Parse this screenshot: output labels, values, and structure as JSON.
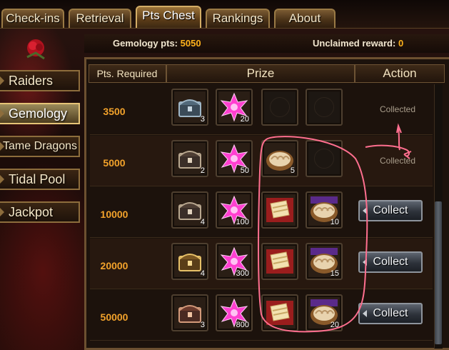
{
  "tabs": [
    {
      "label": "Check-ins",
      "active": false
    },
    {
      "label": "Retrieval",
      "active": false
    },
    {
      "label": "Pts Chest",
      "active": true
    },
    {
      "label": "Rankings",
      "active": false
    },
    {
      "label": "About",
      "active": false
    }
  ],
  "header": {
    "gemology_label": "Gemology pts:",
    "gemology_value": "5050",
    "unclaimed_label": "Unclaimed reward:",
    "unclaimed_value": "0"
  },
  "sidebar": {
    "items": [
      {
        "label": "Raiders",
        "active": false
      },
      {
        "label": "Gemology",
        "active": true
      },
      {
        "label": "Tame Dragons",
        "active": false
      },
      {
        "label": "Tidal Pool",
        "active": false
      },
      {
        "label": "Jackpot",
        "active": false
      }
    ]
  },
  "table": {
    "columns": [
      "Pts. Required",
      "Prize",
      "Action"
    ],
    "rows": [
      {
        "pts": "3500",
        "prizes": [
          {
            "icon": "silver-chest-icon",
            "qty": "3"
          },
          {
            "icon": "pink-star-gem-icon",
            "qty": "20"
          },
          {
            "icon": "empty-slot",
            "qty": ""
          },
          {
            "icon": "empty-slot",
            "qty": ""
          }
        ],
        "action": {
          "type": "status",
          "label": "Collected"
        }
      },
      {
        "pts": "5000",
        "prizes": [
          {
            "icon": "iron-chest-icon",
            "qty": "2"
          },
          {
            "icon": "pink-star-gem-icon",
            "qty": "50"
          },
          {
            "icon": "dumplings-plate-icon",
            "qty": "5"
          },
          {
            "icon": "empty-slot",
            "qty": ""
          }
        ],
        "action": {
          "type": "status",
          "label": "Collected"
        }
      },
      {
        "pts": "10000",
        "prizes": [
          {
            "icon": "iron-chest-icon",
            "qty": "4"
          },
          {
            "icon": "pink-star-gem-icon",
            "qty": "100"
          },
          {
            "icon": "scroll-tray-icon",
            "qty": ""
          },
          {
            "icon": "dumplings-plate-icon",
            "qty": "10"
          }
        ],
        "action": {
          "type": "button",
          "label": "Collect"
        }
      },
      {
        "pts": "20000",
        "prizes": [
          {
            "icon": "gold-chest-icon",
            "qty": "4"
          },
          {
            "icon": "pink-star-gem-icon",
            "qty": "300"
          },
          {
            "icon": "scroll-tray-icon",
            "qty": ""
          },
          {
            "icon": "dumplings-plate-icon",
            "qty": "15"
          }
        ],
        "action": {
          "type": "button",
          "label": "Collect"
        }
      },
      {
        "pts": "50000",
        "prizes": [
          {
            "icon": "bronze-chest-icon",
            "qty": "3"
          },
          {
            "icon": "pink-star-gem-icon",
            "qty": "800"
          },
          {
            "icon": "scroll-tray-icon",
            "qty": ""
          },
          {
            "icon": "dumplings-plate-icon",
            "qty": "20"
          }
        ],
        "action": {
          "type": "button",
          "label": "Collect"
        }
      }
    ]
  },
  "colors": {
    "accent_orange": "#ffb21c",
    "pts_orange": "#f2a22b",
    "annotation_pink": "#ff6f8f"
  }
}
